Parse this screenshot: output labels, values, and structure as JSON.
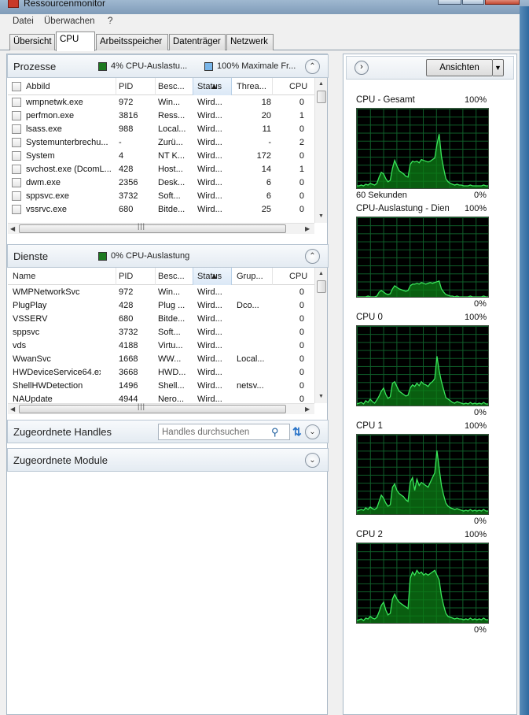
{
  "window": {
    "title": "Ressourcenmonitor"
  },
  "menu": {
    "items": [
      "Datei",
      "Überwachen",
      "?"
    ]
  },
  "tabs": [
    "Übersicht",
    "CPU",
    "Arbeitsspeicher",
    "Datenträger",
    "Netzwerk"
  ],
  "processes": {
    "title": "Prozesse",
    "indicator1": "4% CPU-Auslastu...",
    "indicator1_color": "#1d7a20",
    "indicator2": "100% Maximale Fr...",
    "indicator2_color": "#79b6ea",
    "columns": [
      "Abbild",
      "PID",
      "Besc...",
      "Status",
      "Threa...",
      "CPU"
    ],
    "rows": [
      [
        "wmpnetwk.exe",
        "972",
        "Win...",
        "Wird...",
        "18",
        "0"
      ],
      [
        "perfmon.exe",
        "3816",
        "Ress...",
        "Wird...",
        "20",
        "1"
      ],
      [
        "lsass.exe",
        "988",
        "Local...",
        "Wird...",
        "11",
        "0"
      ],
      [
        "Systemunterbrechu...",
        "-",
        "Zurü...",
        "Wird...",
        "-",
        "2"
      ],
      [
        "System",
        "4",
        "NT K...",
        "Wird...",
        "172",
        "0"
      ],
      [
        "svchost.exe (DcomL...",
        "428",
        "Host...",
        "Wird...",
        "14",
        "1"
      ],
      [
        "dwm.exe",
        "2356",
        "Desk...",
        "Wird...",
        "6",
        "0"
      ],
      [
        "sppsvc.exe",
        "3732",
        "Soft...",
        "Wird...",
        "6",
        "0"
      ],
      [
        "vssrvc.exe",
        "680",
        "Bitde...",
        "Wird...",
        "25",
        "0"
      ]
    ]
  },
  "services": {
    "title": "Dienste",
    "indicator1": "0% CPU-Auslastung",
    "columns": [
      "Name",
      "PID",
      "Besc...",
      "Status",
      "Grup...",
      "CPU"
    ],
    "rows": [
      [
        "WMPNetworkSvc",
        "972",
        "Win...",
        "Wird...",
        "",
        "0"
      ],
      [
        "PlugPlay",
        "428",
        "Plug ...",
        "Wird...",
        "Dco...",
        "0"
      ],
      [
        "VSSERV",
        "680",
        "Bitde...",
        "Wird...",
        "",
        "0"
      ],
      [
        "sppsvc",
        "3732",
        "Soft...",
        "Wird...",
        "",
        "0"
      ],
      [
        "vds",
        "4188",
        "Virtu...",
        "Wird...",
        "",
        "0"
      ],
      [
        "WwanSvc",
        "1668",
        "WW...",
        "Wird...",
        "Local...",
        "0"
      ],
      [
        "HWDeviceService64.exe",
        "3668",
        "HWD...",
        "Wird...",
        "",
        "0"
      ],
      [
        "ShellHWDetection",
        "1496",
        "Shell...",
        "Wird...",
        "netsv...",
        "0"
      ],
      [
        "NAUpdate",
        "4944",
        "Nero...",
        "Wird...",
        "",
        "0"
      ]
    ]
  },
  "handles": {
    "title": "Zugeordnete Handles",
    "search_placeholder": "Handles durchsuchen"
  },
  "modules": {
    "title": "Zugeordnete Module"
  },
  "right": {
    "view_button": "Ansichten",
    "graphs": [
      {
        "label": "CPU - Gesamt",
        "max": "100%",
        "min": "0%",
        "time_label": "60 Sekunden",
        "values": [
          3,
          3,
          4,
          3,
          5,
          4,
          6,
          5,
          4,
          6,
          14,
          20,
          18,
          12,
          8,
          10,
          25,
          35,
          28,
          22,
          20,
          18,
          15,
          14,
          30,
          34,
          33,
          34,
          32,
          36,
          35,
          34,
          33,
          34,
          36,
          38,
          55,
          68,
          40,
          25,
          12,
          8,
          6,
          5,
          4,
          5,
          4,
          4,
          3,
          3,
          3,
          4,
          3,
          3,
          3,
          3,
          3,
          4,
          3,
          3
        ]
      },
      {
        "label": "CPU-Auslastung - Dien...",
        "max": "100%",
        "min": "0%",
        "values": [
          0,
          0,
          0,
          0,
          0,
          1,
          0,
          0,
          0,
          1,
          6,
          8,
          6,
          4,
          3,
          4,
          10,
          14,
          12,
          10,
          9,
          8,
          7,
          8,
          14,
          16,
          16,
          17,
          16,
          18,
          17,
          16,
          17,
          18,
          17,
          18,
          19,
          20,
          10,
          6,
          3,
          2,
          1,
          1,
          0,
          1,
          0,
          0,
          0,
          0,
          0,
          1,
          0,
          0,
          0,
          0,
          0,
          1,
          0,
          0
        ]
      },
      {
        "label": "CPU 0",
        "max": "100%",
        "min": "0%",
        "values": [
          2,
          3,
          4,
          2,
          6,
          4,
          8,
          5,
          3,
          7,
          12,
          18,
          22,
          14,
          9,
          11,
          28,
          30,
          24,
          18,
          16,
          14,
          12,
          13,
          22,
          26,
          24,
          28,
          25,
          30,
          27,
          26,
          24,
          28,
          30,
          34,
          62,
          44,
          30,
          20,
          10,
          8,
          6,
          4,
          3,
          5,
          4,
          3,
          2,
          3,
          2,
          4,
          2,
          3,
          2,
          3,
          2,
          4,
          2,
          2
        ]
      },
      {
        "label": "CPU 1",
        "max": "100%",
        "min": "0%",
        "values": [
          4,
          5,
          6,
          5,
          8,
          6,
          9,
          7,
          6,
          8,
          16,
          24,
          20,
          14,
          10,
          12,
          34,
          38,
          30,
          26,
          24,
          22,
          18,
          16,
          40,
          46,
          30,
          44,
          36,
          40,
          38,
          36,
          34,
          40,
          46,
          52,
          80,
          58,
          36,
          24,
          14,
          10,
          8,
          7,
          6,
          7,
          6,
          5,
          4,
          5,
          4,
          6,
          4,
          5,
          4,
          5,
          4,
          6,
          4,
          4
        ]
      },
      {
        "label": "CPU 2",
        "max": "100%",
        "min": "0%",
        "values": [
          3,
          4,
          5,
          3,
          6,
          5,
          8,
          6,
          5,
          7,
          14,
          22,
          26,
          16,
          10,
          12,
          30,
          36,
          30,
          26,
          24,
          22,
          20,
          18,
          56,
          64,
          60,
          66,
          62,
          64,
          60,
          62,
          60,
          62,
          64,
          66,
          60,
          54,
          34,
          22,
          12,
          8,
          7,
          6,
          5,
          6,
          5,
          5,
          4,
          5,
          4,
          6,
          4,
          5,
          4,
          5,
          4,
          6,
          4,
          4
        ]
      }
    ]
  }
}
